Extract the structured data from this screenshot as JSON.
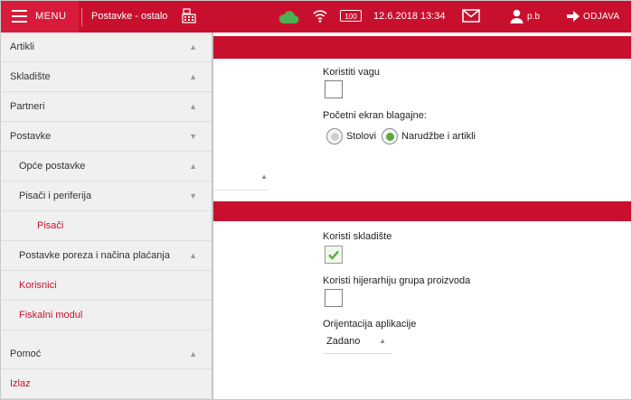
{
  "topbar": {
    "menu_label": "MENU",
    "title": "Postavke - ostalo",
    "battery": "100",
    "datetime": "12.6.2018 13:34",
    "user": "p.b",
    "logout_label": "ODJAVA",
    "colors": {
      "bar": "#c8102e",
      "cloud": "#4caf50"
    }
  },
  "sidebar": {
    "items": [
      {
        "label": "Artikli",
        "chevron": "▲"
      },
      {
        "label": "Skladište",
        "chevron": "▲"
      },
      {
        "label": "Partneri",
        "chevron": "▲"
      },
      {
        "label": "Postavke",
        "chevron": "▼"
      },
      {
        "label": "Opće postavke",
        "chevron": "▲"
      },
      {
        "label": "Pisači i periferija",
        "chevron": "▼"
      },
      {
        "label": "Pisači",
        "chevron": ""
      },
      {
        "label": "Postavke poreza i načina plaćanja",
        "chevron": "▲"
      },
      {
        "label": "Korisnici",
        "chevron": ""
      },
      {
        "label": "Fiskalni modul",
        "chevron": ""
      },
      {
        "label": "Pomoć",
        "chevron": "▲"
      },
      {
        "label": "Izlaz",
        "chevron": ""
      }
    ]
  },
  "content": {
    "koristiti_vagu": {
      "label": "Koristiti vagu",
      "checked": false
    },
    "pocetni_ekran": {
      "label": "Početni ekran blagajne:",
      "options": [
        "Stolovi",
        "Narudžbe i artikli"
      ],
      "selected": "Narudžbe i artikli"
    },
    "partial_select_arrow": "▲",
    "koristi_skladiste": {
      "label": "Koristi skladište",
      "checked": true
    },
    "hijerarhija": {
      "label": "Koristi hijerarhiju grupa proizvoda",
      "checked": false
    },
    "orijentacija": {
      "label": "Orijentacija aplikacije",
      "value": "Zadano",
      "arrow": "▲"
    }
  }
}
